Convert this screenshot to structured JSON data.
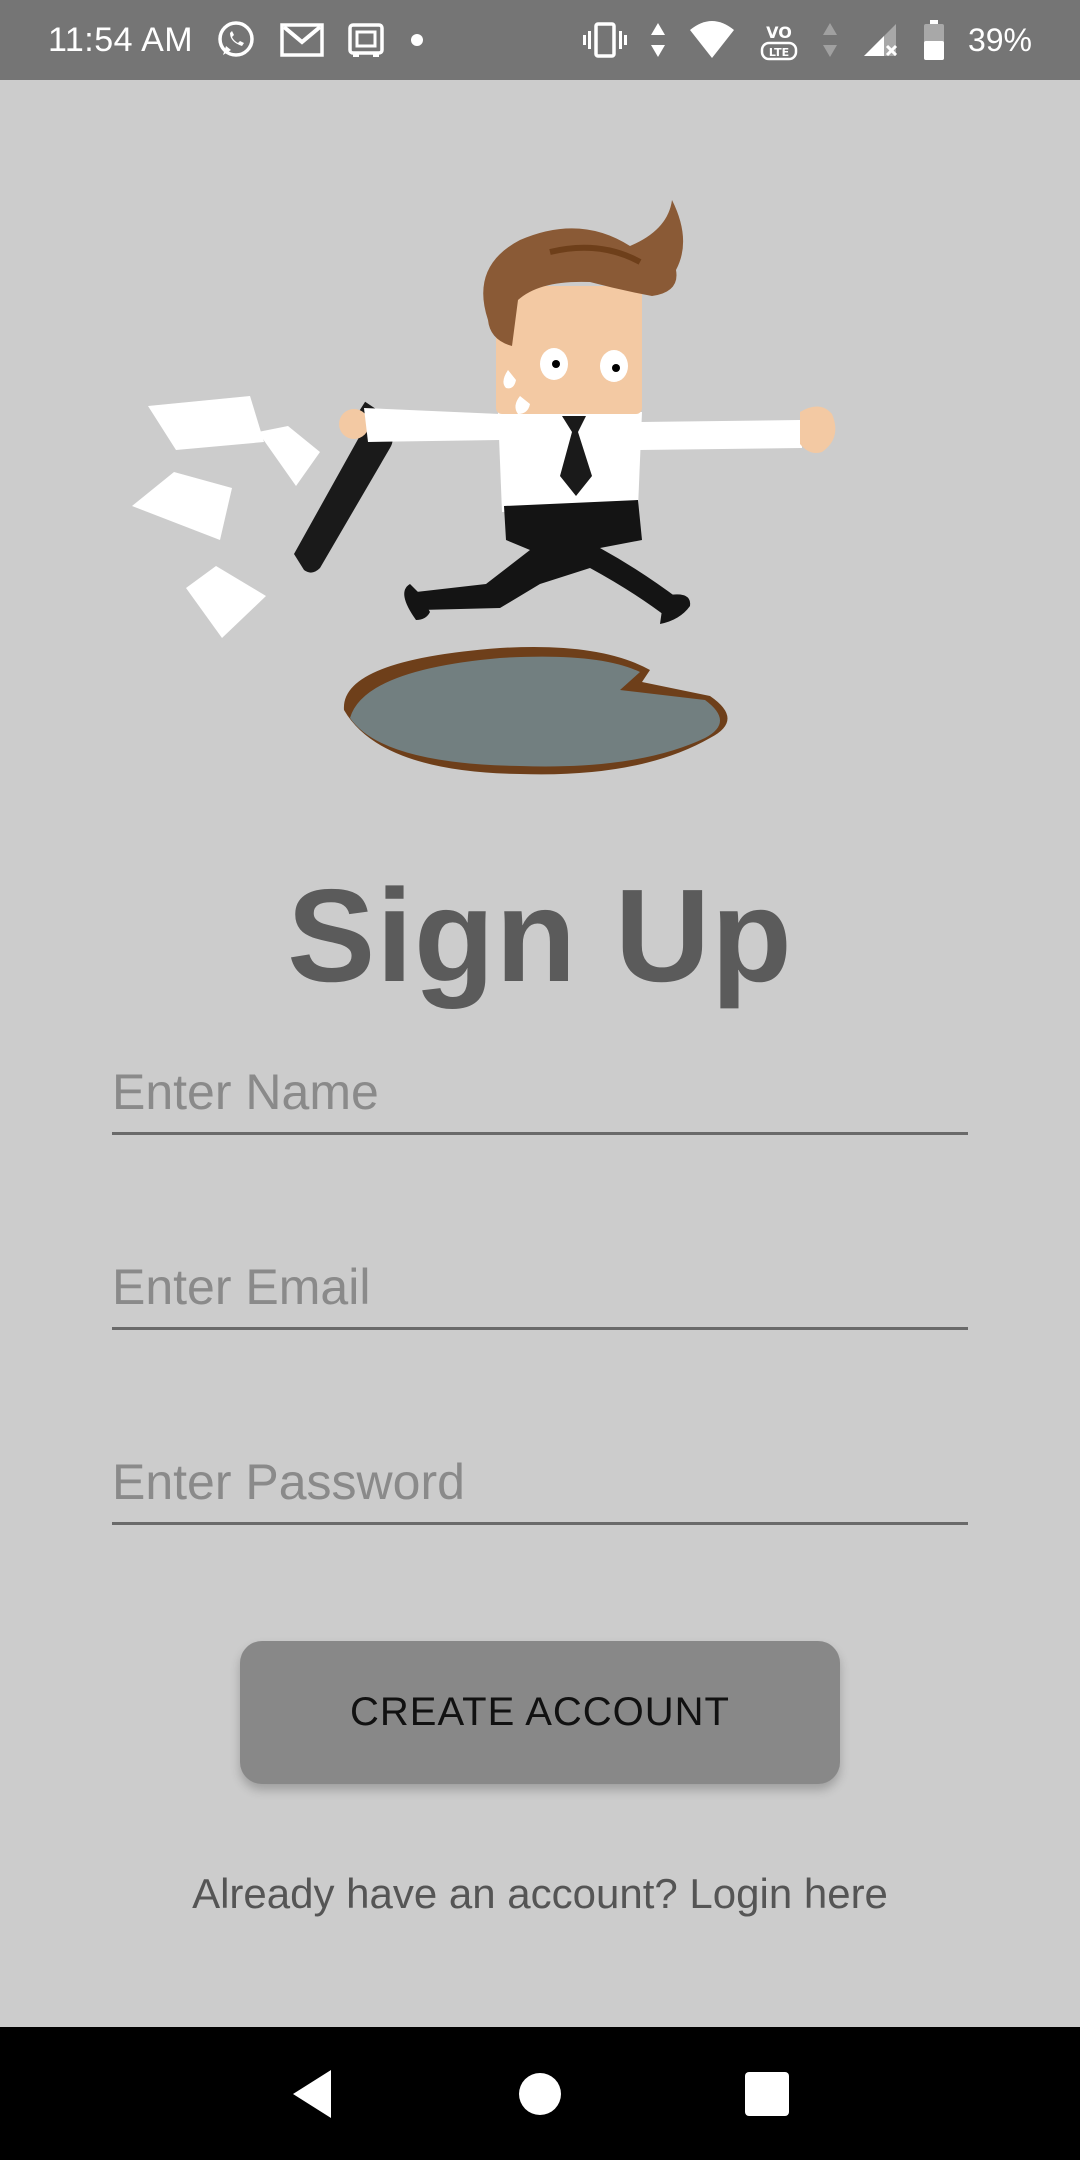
{
  "status_bar": {
    "time": "11:54 AM",
    "battery_percent": "39%",
    "icons": [
      "whatsapp-icon",
      "gmail-icon",
      "vault-icon",
      "dot-icon",
      "vibrate-icon",
      "data-arrows-icon",
      "wifi-icon",
      "volte-icon",
      "signal-icon",
      "battery-icon"
    ]
  },
  "page": {
    "title": "Sign Up"
  },
  "form": {
    "name_placeholder": "Enter Name",
    "email_placeholder": "Enter Email",
    "password_placeholder": "Enter Password",
    "submit_label": "CREATE ACCOUNT",
    "login_prompt": "Already have an account? Login here"
  },
  "navigation": {
    "buttons": [
      "back",
      "home",
      "recents"
    ]
  },
  "colors": {
    "background": "#cccccc",
    "status_bar": "#757575",
    "title": "#5b5b5b",
    "button": "#888888",
    "nav_bar": "#000000"
  }
}
